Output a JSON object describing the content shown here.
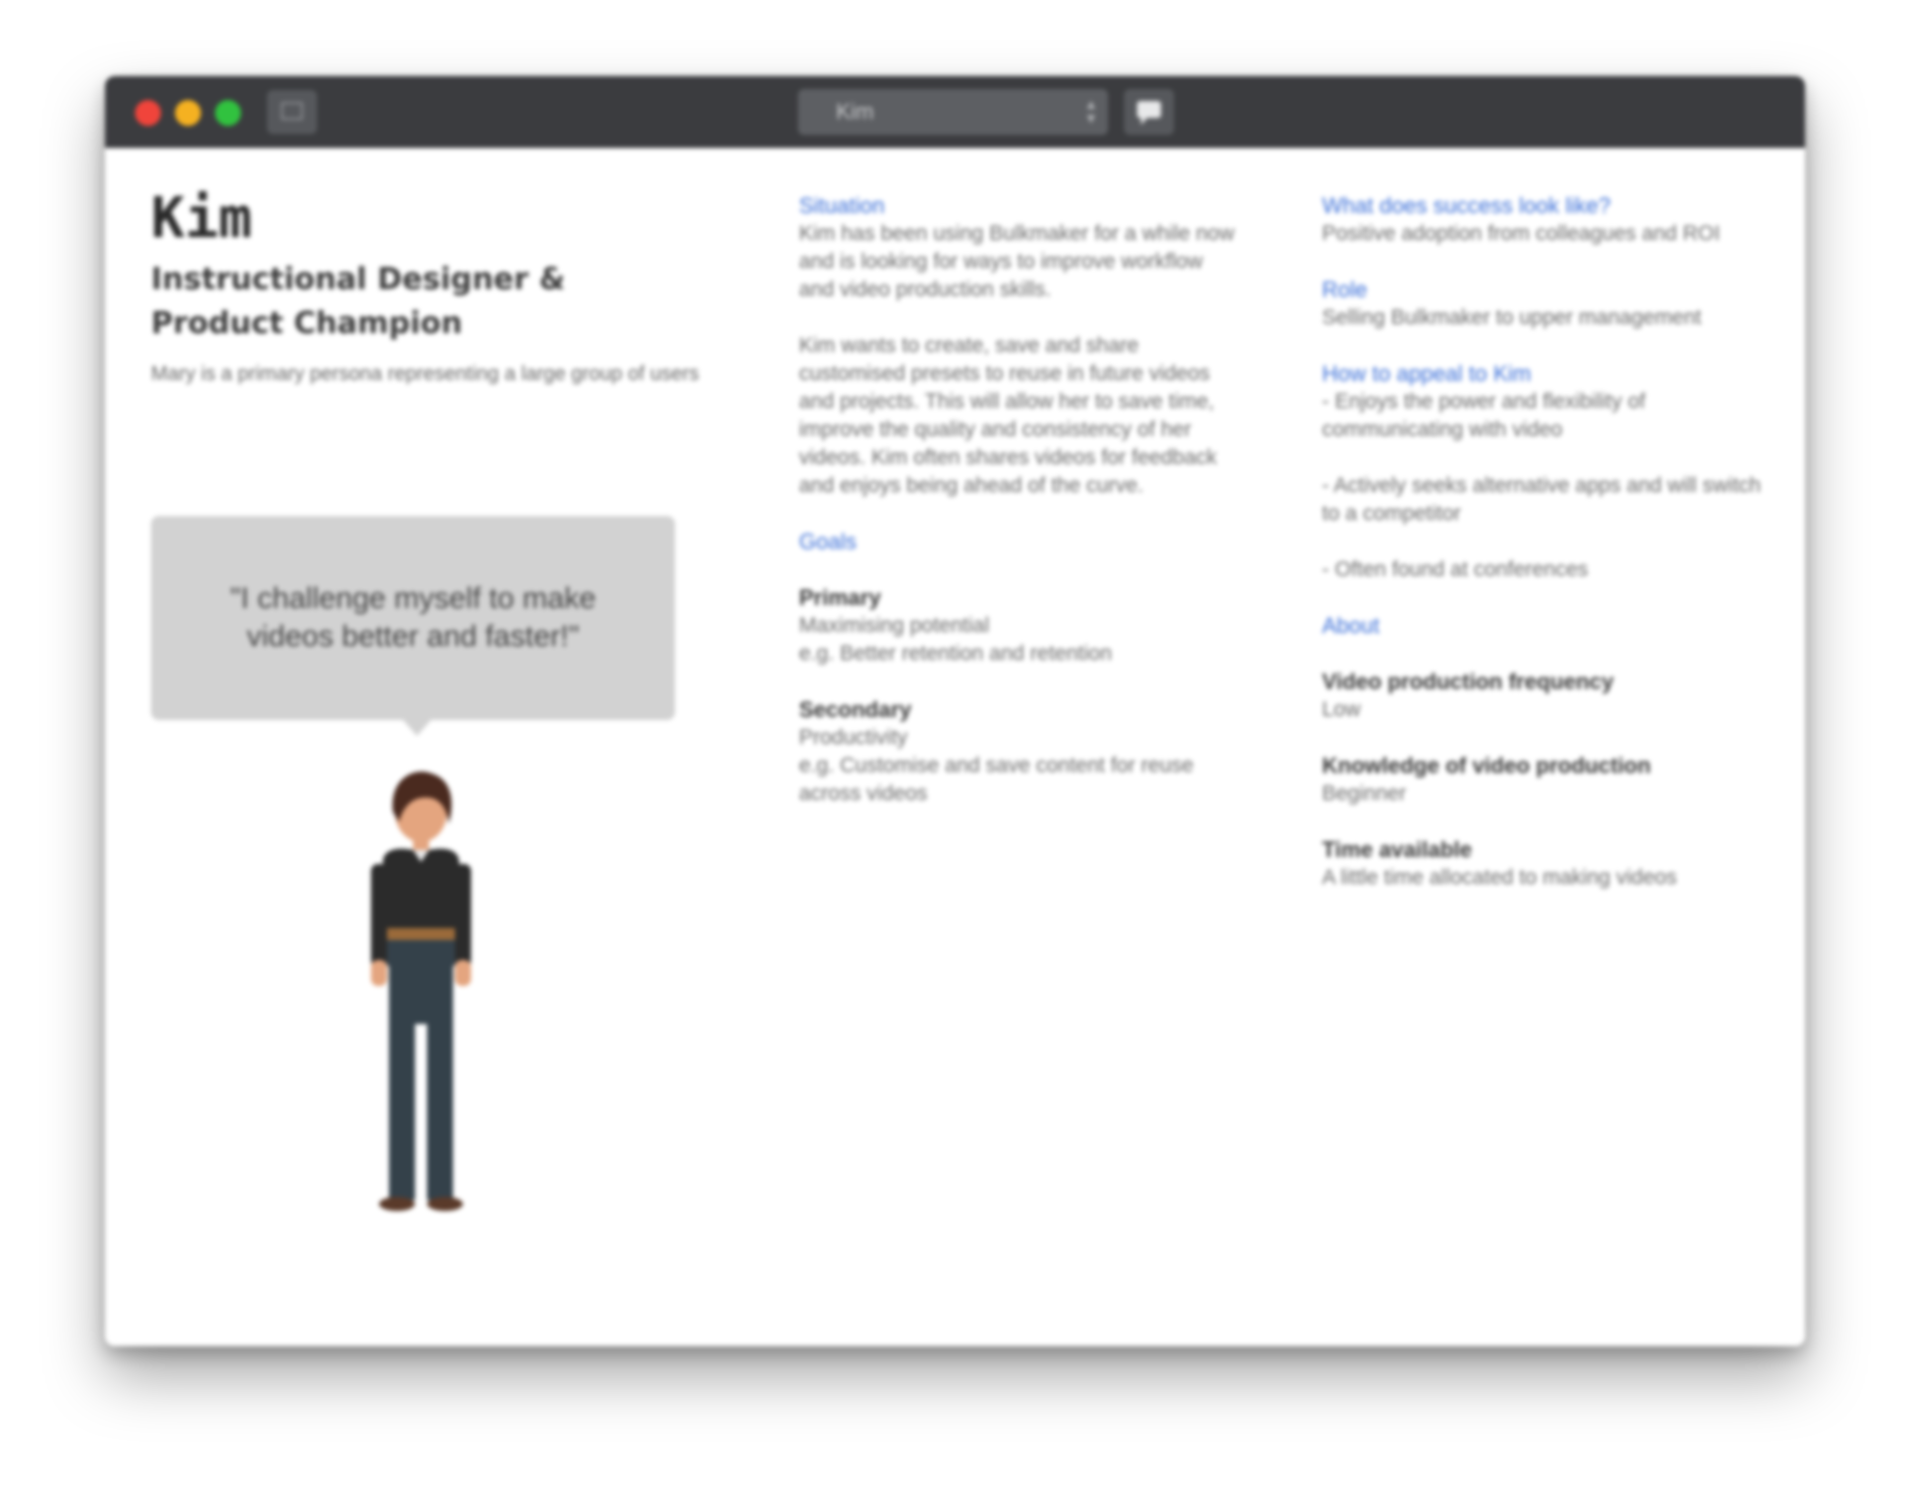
{
  "window": {
    "document_name": "Kim",
    "colors": {
      "close": "#f0443b",
      "minimize": "#f5b121",
      "zoom": "#31c23f",
      "titlebar": "#3b3c3f",
      "accent": "#3b6fd8",
      "quote_bg": "#d2d2d2"
    },
    "icons": [
      "close-icon",
      "minimize-icon",
      "zoom-icon",
      "sidebar-icon",
      "chevron-updown-icon",
      "comment-icon"
    ]
  },
  "persona": {
    "name": "Kim",
    "role": "Instructional Designer & Product Champion",
    "description": "Mary is a primary persona representing a large group of users",
    "quote": "\"I challenge myself to make videos better and faster!\""
  },
  "situation": {
    "heading": "Situation",
    "paragraph1": "Kim has been using Bulkmaker for a while now and is looking for ways to improve workflow and video production skills.",
    "paragraph2": "Kim wants to create, save and share customised presets to reuse in future videos and projects. This will allow her to save time, improve the quality and consistency of her videos. Kim often shares videos for feedback and enjoys being ahead of the curve."
  },
  "goals": {
    "heading": "Goals",
    "primary_label": "Primary",
    "primary_line1": "Maximising potential",
    "primary_line2": "e.g. Better retention and retention",
    "secondary_label": "Secondary",
    "secondary_line1": "Productivity",
    "secondary_line2": "e.g. Customise and save content for reuse across videos"
  },
  "success": {
    "heading": "What does success look like?",
    "text": "Positive adoption from colleagues and ROI"
  },
  "role_section": {
    "heading": "Role",
    "text": "Selling Bulkmaker to upper management"
  },
  "appeal": {
    "heading": "How to appeal to Kim",
    "item1": "- Enjoys the power and flexibility of communicating with video",
    "item2": "- Actively seeks alternative apps and will switch to a competitor",
    "item3": "- Often found at conferences"
  },
  "about": {
    "heading": "About",
    "freq_label": "Video production frequency",
    "freq_value": "Low",
    "knowledge_label": "Knowledge of video production",
    "knowledge_value": "Beginner",
    "time_label": "Time available",
    "time_value": "A little time allocated to making videos"
  }
}
